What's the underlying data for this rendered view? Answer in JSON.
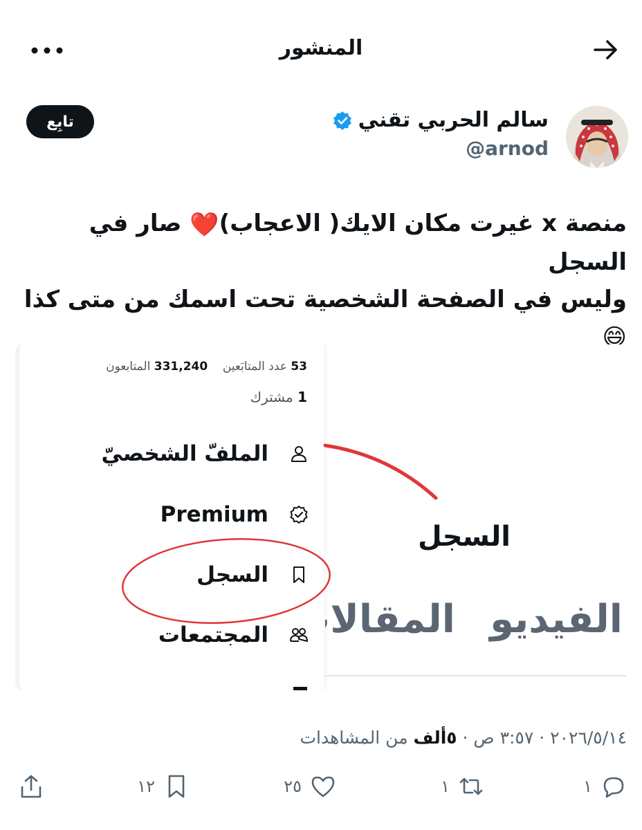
{
  "header": {
    "title": "المنشور",
    "back_icon": "arrow-right-icon",
    "more_icon": "more-dots-icon"
  },
  "author": {
    "name": "سالم الحربي تقني",
    "handle": "@arnod",
    "verified_icon": "verified-badge-icon",
    "follow_label": "تابِع"
  },
  "post": {
    "line1": "منصة x غيرت مكان الايك( الاعجاب)",
    "line1_after": "صار في السجل",
    "line2": "وليس في الصفحة الشخصية تحت اسمك من متى كذا",
    "heart_emoji": "❤️",
    "grin_emoji": "😄"
  },
  "media": {
    "stats_following_num": "53",
    "stats_following_label": "عدد المتابَعين",
    "stats_followers_num": "331,240",
    "stats_followers_label": "المتابعون",
    "subscribers_num": "1",
    "subscribers_label": "مشترك",
    "menu": [
      {
        "label": "الملفّ الشخصيّ",
        "icon": "person-icon"
      },
      {
        "label": "Premium",
        "icon": "premium-badge-icon"
      },
      {
        "label": "السجل",
        "icon": "bookmark-icon"
      },
      {
        "label": "المجتمعات",
        "icon": "communities-icon"
      }
    ],
    "zoom_label": "السجل",
    "zoom_tab_1": "الفيديو",
    "zoom_tab_2": "المقالات"
  },
  "meta": {
    "date": "٢٠٢٦/٥/١٤",
    "time": "٣:٥٧ ص",
    "views_num": "٥ألف",
    "views_label": "من المشاهدات",
    "sep": "·"
  },
  "actions": {
    "replies": "١",
    "reposts": "١",
    "likes": "٢٥",
    "bookmarks": "١٢"
  },
  "colors": {
    "accent": "#1d9bf0",
    "text": "#0f1419",
    "muted": "#536471",
    "annotation_red": "#e0363a"
  }
}
